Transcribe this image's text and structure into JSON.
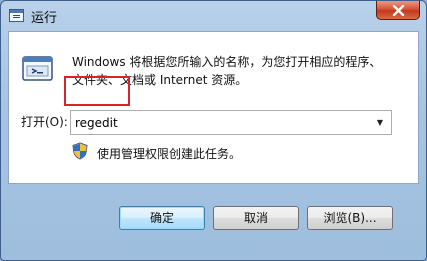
{
  "window": {
    "title": "运行",
    "close_icon": "close-icon"
  },
  "description": {
    "line1": "Windows 将根据您所输入的名称，为您打开相应的程序、",
    "line2": "文件夹、文档或 Internet 资源。"
  },
  "open_field": {
    "label": "打开(O):",
    "value": "regedit"
  },
  "admin_note": "使用管理权限创建此任务。",
  "buttons": {
    "ok": "确定",
    "cancel": "取消",
    "browse": "浏览(B)..."
  },
  "colors": {
    "highlight": "#d9232a",
    "close_button": "#c2391d"
  }
}
